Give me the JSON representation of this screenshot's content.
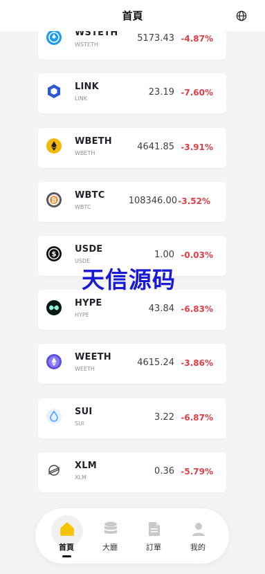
{
  "header": {
    "title": "首頁",
    "globe_icon": "globe-icon"
  },
  "watermark": "天信源码",
  "colors": {
    "negative": "#e03e46",
    "active_tab": "#f5c400"
  },
  "coins": [
    {
      "symbol": "WSTETH",
      "name": "WSTETH",
      "price": "5173.43",
      "change": "-4.87%",
      "icon": "wsteth-icon"
    },
    {
      "symbol": "LINK",
      "name": "LINK",
      "price": "23.19",
      "change": "-7.60%",
      "icon": "link-icon"
    },
    {
      "symbol": "WBETH",
      "name": "WBETH",
      "price": "4641.85",
      "change": "-3.91%",
      "icon": "wbeth-icon"
    },
    {
      "symbol": "WBTC",
      "name": "WBTC",
      "price": "108346.00",
      "change": "-3.52%",
      "icon": "wbtc-icon"
    },
    {
      "symbol": "USDE",
      "name": "USDE",
      "price": "1.00",
      "change": "-0.03%",
      "icon": "usde-icon"
    },
    {
      "symbol": "HYPE",
      "name": "HYPE",
      "price": "43.84",
      "change": "-6.83%",
      "icon": "hype-icon"
    },
    {
      "symbol": "WEETH",
      "name": "WEETH",
      "price": "4615.24",
      "change": "-3.86%",
      "icon": "weeth-icon"
    },
    {
      "symbol": "SUI",
      "name": "SUI",
      "price": "3.22",
      "change": "-6.87%",
      "icon": "sui-icon"
    },
    {
      "symbol": "XLM",
      "name": "XLM",
      "price": "0.36",
      "change": "-5.79%",
      "icon": "xlm-icon"
    }
  ],
  "tabs": [
    {
      "label": "首頁",
      "icon": "home-icon",
      "active": true
    },
    {
      "label": "大廳",
      "icon": "database-icon",
      "active": false
    },
    {
      "label": "訂單",
      "icon": "document-icon",
      "active": false
    },
    {
      "label": "我的",
      "icon": "user-icon",
      "active": false
    }
  ]
}
